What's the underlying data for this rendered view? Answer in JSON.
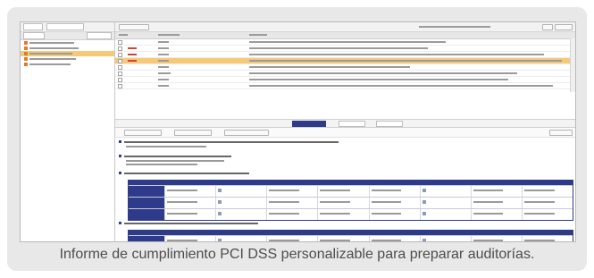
{
  "caption": "Informe de cumplimiento PCI DSS personalizable para preparar auditorías.",
  "colors": {
    "accent": "#2e3b8a",
    "highlight": "#f6c978",
    "alert": "#d0453b",
    "card": "#e8e8e8"
  },
  "icons": [
    "checkbox-icon",
    "folder-icon",
    "status-icon"
  ]
}
